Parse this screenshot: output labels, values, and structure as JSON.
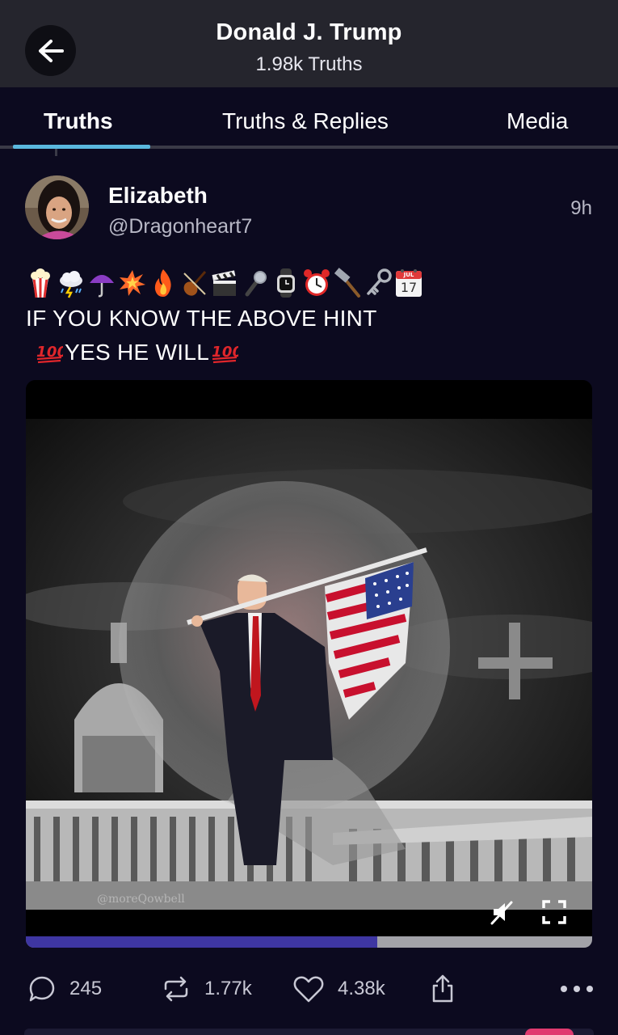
{
  "header": {
    "title": "Donald J. Trump",
    "subtitle": "1.98k Truths",
    "back_icon": "arrow-left-icon"
  },
  "tabs": [
    {
      "label": "Truths",
      "active": true
    },
    {
      "label": "Truths & Replies",
      "active": false
    },
    {
      "label": "Media",
      "active": false
    }
  ],
  "post": {
    "author_name": "Elizabeth",
    "author_handle": "@Dragonheart7",
    "time": "9h",
    "emoji_hint": [
      "popcorn",
      "cloud-with-lightning-and-rain",
      "umbrella",
      "explosion",
      "fire",
      "violin-and-bow",
      "clapper-board",
      "microphone",
      "watch",
      "alarm-clock",
      "hammer",
      "key",
      "calendar"
    ],
    "calendar_month": "JUL",
    "calendar_day": "17",
    "line1": "IF YOU KNOW THE ABOVE HINT",
    "line2_emoji": "hundred-points",
    "line2_text": "YES HE WILL",
    "media": {
      "type": "video",
      "watermark": "@moreQowbell",
      "progress": 0.62,
      "mute_icon": "muted-speaker-icon",
      "fullscreen_icon": "fullscreen-icon"
    },
    "actions": {
      "replies": "245",
      "retruths": "1.77k",
      "likes": "4.38k",
      "share_icon": "share-icon",
      "more_icon": "more-dots-icon"
    }
  },
  "colors": {
    "background": "#0c0a1f",
    "header_bg": "#25252d",
    "tab_indicator": "#5ab8de",
    "progress_fill": "#3e36a2",
    "progress_track": "#a2a2a8"
  }
}
